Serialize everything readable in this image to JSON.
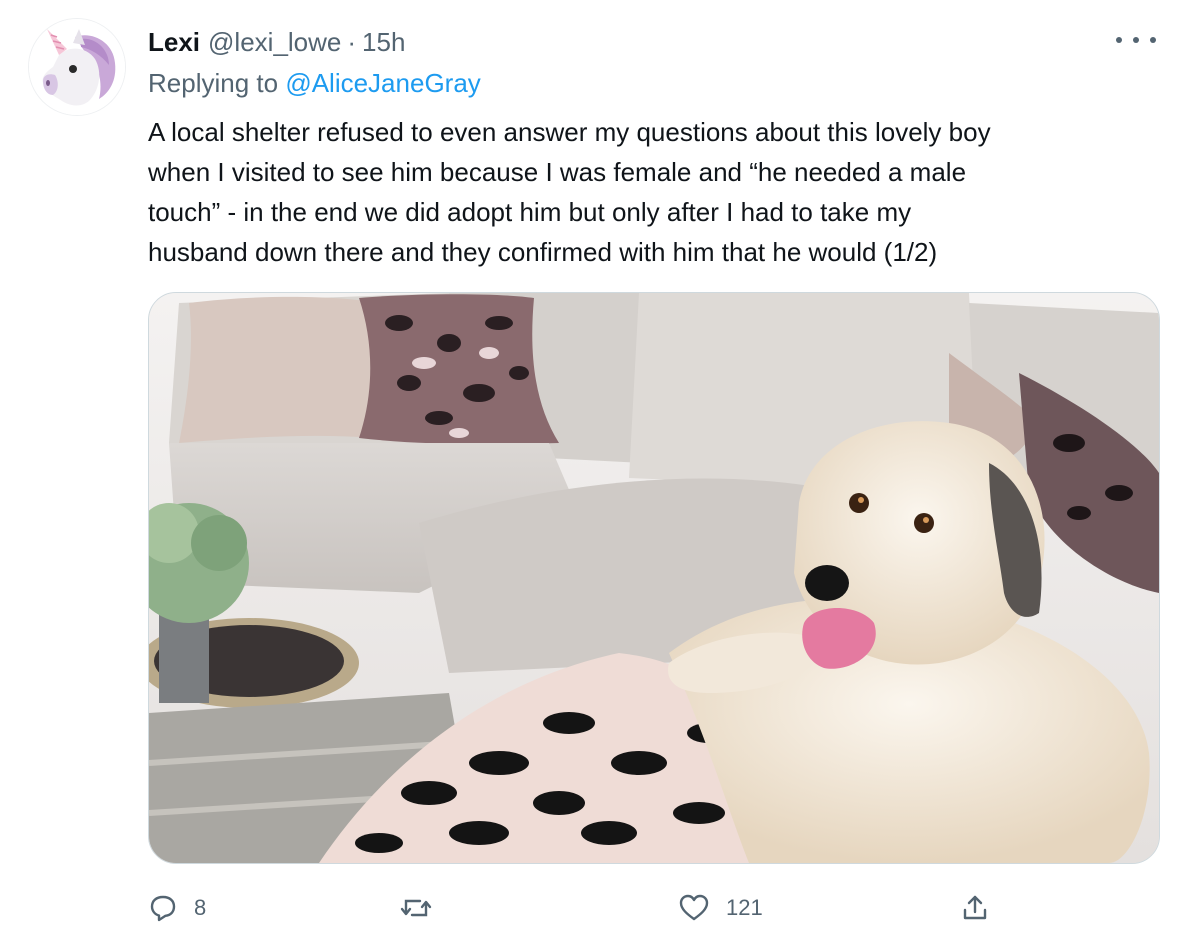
{
  "author": {
    "display_name": "Lexi",
    "handle": "@lexi_lowe",
    "separator": "·",
    "time": "15h",
    "avatar_icon": "unicorn-icon"
  },
  "reply": {
    "prefix": "Replying to",
    "mention": "@AliceJaneGray"
  },
  "body_lines": [
    "A local shelter refused to even answer my questions about this lovely boy",
    "when I visited to see him because I was female and “he needed a male",
    "touch” - in the end we did adopt him but only after I had to take my",
    "husband down there and they confirmed with him that he would (1/2)"
  ],
  "media": {
    "description_icon": "dog-on-sofa-photo"
  },
  "actions": {
    "reply_count": "8",
    "retweet_count": "",
    "like_count": "121",
    "share_count": ""
  },
  "colors": {
    "secondary_text": "#536471",
    "link": "#1d9bf0",
    "primary_text": "#0f1419"
  }
}
